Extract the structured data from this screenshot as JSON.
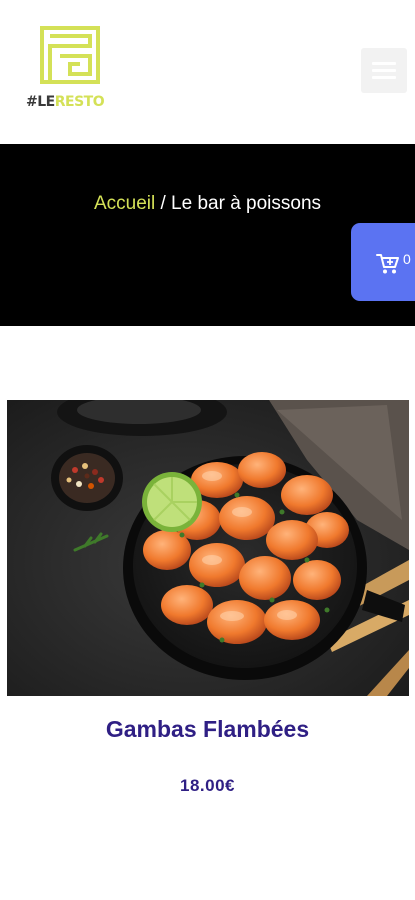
{
  "header": {
    "logo_text_part1": "#LE",
    "logo_text_part2": "RESTO",
    "menu_icon": "hamburger-icon"
  },
  "breadcrumb": {
    "home": "Accueil",
    "separator": " / ",
    "current": "Le bar à poissons"
  },
  "cart": {
    "icon": "cart-icon",
    "count": "0"
  },
  "product": {
    "name": "Gambas Flambées",
    "price": "18.00€"
  },
  "colors": {
    "accent_yellow": "#d4e157",
    "cart_blue": "#5b73f2",
    "product_text": "#2f1f84",
    "hero_background": "#000000"
  }
}
